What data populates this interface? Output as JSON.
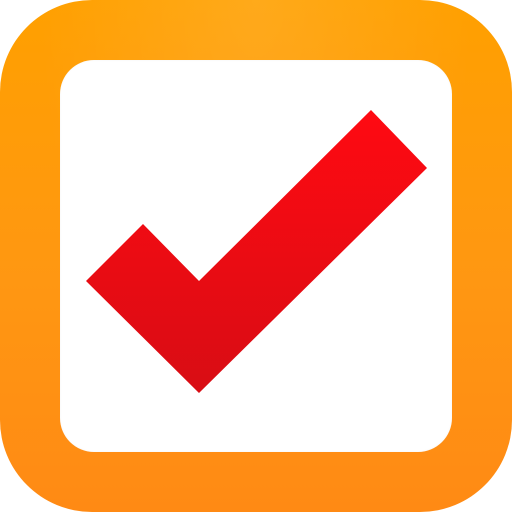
{
  "app_icon": {
    "icon_name": "checkmark-icon",
    "frame_color": "#ff9a0a",
    "box_color": "#ffffff",
    "check_color": "#e5000a"
  }
}
